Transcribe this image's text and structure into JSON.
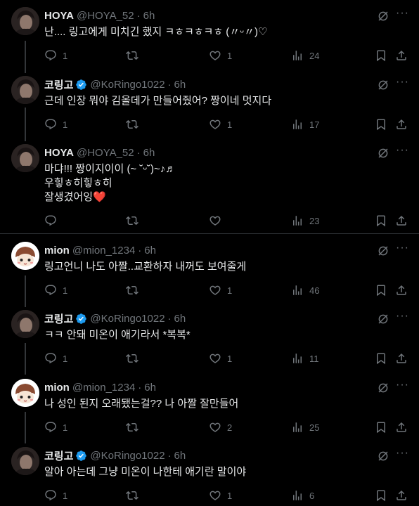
{
  "tweets": [
    {
      "name": "HOYA",
      "handle": "@HOYA_52",
      "time": "6h",
      "verified": false,
      "avatar": "dark",
      "text": "난.... 링고에게 미치긴 했지 ㅋㅎㅋㅎㅋㅎ (〃ᵕ〃)♡",
      "replies": "1",
      "reposts": "",
      "likes": "1",
      "views": "24"
    },
    {
      "name": "코링고",
      "handle": "@KoRingo1022",
      "time": "6h",
      "verified": true,
      "avatar": "dark",
      "text": "근데 인장 뭐야 김올데가 만들어줬어? 짱이네 멋지다",
      "replies": "1",
      "reposts": "",
      "likes": "1",
      "views": "17"
    },
    {
      "name": "HOYA",
      "handle": "@HOYA_52",
      "time": "6h",
      "verified": false,
      "avatar": "dark",
      "text": "마댜!!! 짱이지이이 (~ ˘ᵕ˘)~♪♬\n우힣ㅎ히힣ㅎ히\n잘생겼어잉",
      "emoji": "❤️",
      "replies": "",
      "reposts": "",
      "likes": "",
      "views": "23"
    },
    {
      "name": "mion",
      "handle": "@mion_1234",
      "time": "6h",
      "verified": false,
      "avatar": "mion",
      "text": "링고언니 나도 아짤..교환하자 내꺼도 보여줄게",
      "replies": "1",
      "reposts": "",
      "likes": "1",
      "views": "46"
    },
    {
      "name": "코링고",
      "handle": "@KoRingo1022",
      "time": "6h",
      "verified": true,
      "avatar": "dark",
      "text": "ㅋㅋ 안돼 미온이 애기라서 *복복*",
      "replies": "1",
      "reposts": "",
      "likes": "1",
      "views": "11"
    },
    {
      "name": "mion",
      "handle": "@mion_1234",
      "time": "6h",
      "verified": false,
      "avatar": "mion",
      "text": "나 성인 된지 오래됐는걸?? 나 아짤 잘만들어",
      "replies": "1",
      "reposts": "",
      "likes": "2",
      "views": "25"
    },
    {
      "name": "코링고",
      "handle": "@KoRingo1022",
      "time": "6h",
      "verified": true,
      "avatar": "dark",
      "text": "알아 아는데 그냥 미온이 나한테 애기란 말이야",
      "replies": "1",
      "reposts": "",
      "likes": "1",
      "views": "6"
    }
  ],
  "colors": {
    "background": "#000000",
    "text": "#e7e9ea",
    "muted": "#71767b",
    "verified": "#1d9bf0",
    "divider": "#2f3336"
  },
  "icons": [
    "reply-icon",
    "repost-icon",
    "like-icon",
    "views-icon",
    "bookmark-icon",
    "share-icon",
    "grok-icon",
    "more-icon",
    "verified-badge-icon"
  ]
}
